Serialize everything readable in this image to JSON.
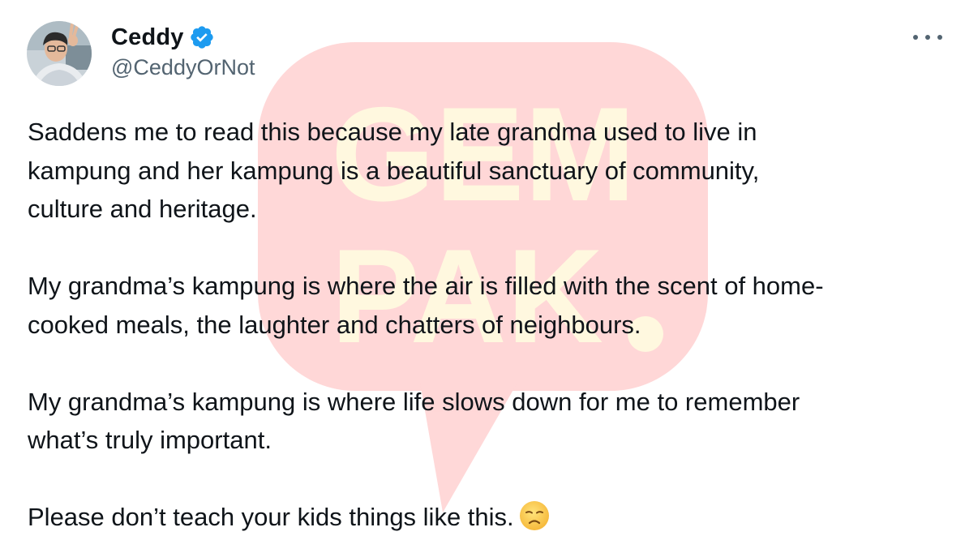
{
  "author": {
    "display_name": "Ceddy",
    "handle": "@CeddyOrNot",
    "verified": true
  },
  "tweet": {
    "paragraphs": [
      "Saddens me to read this because my late grandma used to live in\nkampung and her kampung is a beautiful sanctuary of community,\nculture and heritage.",
      "My grandma’s kampung is where the air is filled with the scent of home-\ncooked meals, the laughter and chatters of neighbours.",
      "My grandma’s kampung is where life slows down for me to remember\nwhat’s truly important.",
      "Please don’t teach your kids things like this."
    ],
    "final_emoji": "disappointed-face"
  },
  "watermark": {
    "lines": [
      "GEM",
      "PAK"
    ]
  },
  "icons": {
    "verified_badge": "verified-badge-icon",
    "more": "more-options-icon"
  },
  "colors": {
    "text": "#0f1419",
    "secondary_text": "#536471",
    "verified_blue": "#1d9bf0",
    "watermark_red": "#ff4d4d",
    "watermark_yellow": "#ffe066"
  }
}
